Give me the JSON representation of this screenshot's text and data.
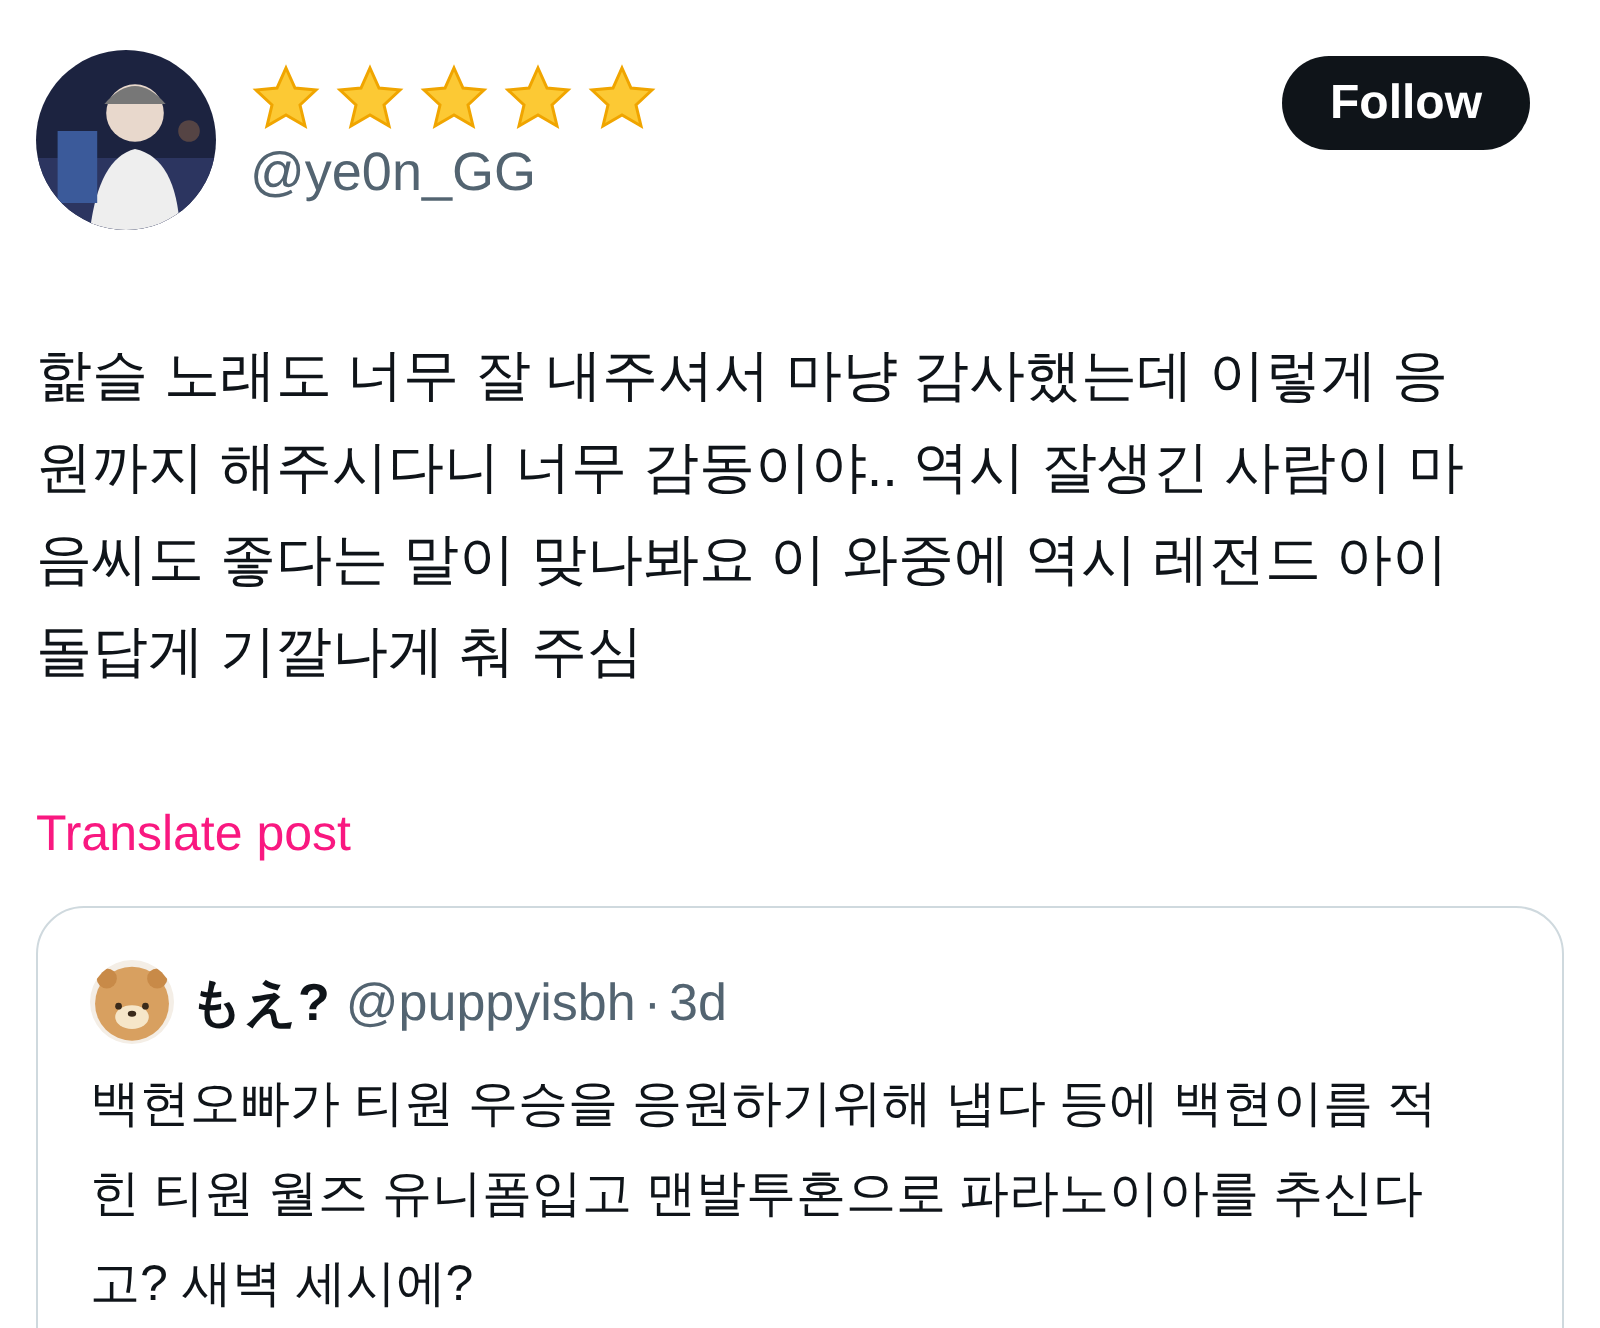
{
  "author": {
    "handle": "@ye0n_GG"
  },
  "follow_button": "Follow",
  "post_text": "핥슬 노래도 너무 잘 내주셔서 마냥 감사했는데 이렇게 응\n원까지 해주시다니 너무 감동이야.. 역시 잘생긴 사람이 마\n음씨도 좋다는 말이 맞나봐요 이 와중에 역시 레전드 아이\n돌답게 기깔나게 춰 주심",
  "translate_link": "Translate post",
  "quoted_post": {
    "name": "もえ?",
    "handle": "@puppyisbh",
    "separator": "·",
    "time": "3d",
    "text": "백현오빠가 티원 우승을 응원하기위해 냅다 등에 백현이름 적\n힌 티원 월즈 유니폼입고 맨발투혼으로 파라노이아를 추신다\n고? 새벽 세시에?"
  }
}
